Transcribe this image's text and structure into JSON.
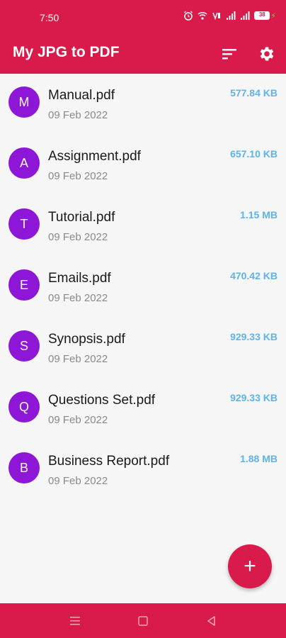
{
  "status_bar": {
    "time": "7:50",
    "battery_level": "38",
    "icons": [
      "alarm-icon",
      "wifi-icon",
      "volte-icon",
      "signal-icon",
      "signal-icon",
      "battery-icon",
      "charging-icon"
    ]
  },
  "app_bar": {
    "title": "My JPG to PDF",
    "actions": [
      "sort-icon",
      "settings-gear-icon"
    ]
  },
  "files": [
    {
      "initial": "M",
      "name": "Manual.pdf",
      "date": "09 Feb 2022",
      "size": "577.84 KB"
    },
    {
      "initial": "A",
      "name": "Assignment.pdf",
      "date": "09 Feb 2022",
      "size": "657.10 KB"
    },
    {
      "initial": "T",
      "name": "Tutorial.pdf",
      "date": "09 Feb 2022",
      "size": "1.15 MB"
    },
    {
      "initial": "E",
      "name": "Emails.pdf",
      "date": "09 Feb 2022",
      "size": "470.42 KB"
    },
    {
      "initial": "S",
      "name": "Synopsis.pdf",
      "date": "09 Feb 2022",
      "size": "929.33 KB"
    },
    {
      "initial": "Q",
      "name": "Questions Set.pdf",
      "date": "09 Feb 2022",
      "size": "929.33 KB"
    },
    {
      "initial": "B",
      "name": "Business Report.pdf",
      "date": "09 Feb 2022",
      "size": "1.88 MB"
    }
  ],
  "fab": {
    "label": "+"
  },
  "colors": {
    "primary": "#d81b4a",
    "avatar": "#8e16d6",
    "size_text": "#5eb3ea",
    "date_text": "#8a8a8a",
    "background": "#f6f6f6"
  }
}
